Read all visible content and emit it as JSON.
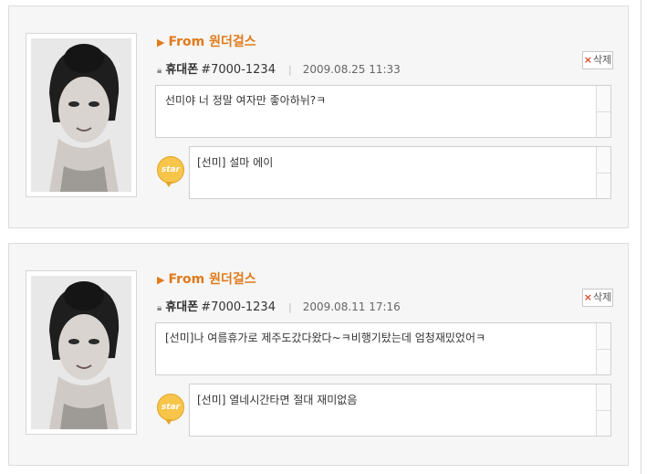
{
  "posts": [
    {
      "from_label": "From",
      "from_name": "원더걸스",
      "sender": "휴대폰",
      "phone": "#7000-1234",
      "date": "2009.08.25 11:33",
      "delete_label": "삭제",
      "message": "선미야 너 정말 여자만 좋아하뉘?ㅋ",
      "reply_badge": "star",
      "reply": "[선미] 설마 에이"
    },
    {
      "from_label": "From",
      "from_name": "원더걸스",
      "sender": "휴대폰",
      "phone": "#7000-1234",
      "date": "2009.08.11 17:16",
      "delete_label": "삭제",
      "message": "[선미]나 여름휴가로 제주도갔다왔다~ㅋ비행기탔는데 엄청재밌었어ㅋ",
      "reply_badge": "star",
      "reply": "[선미] 열네시간타면 절대 재미없음"
    }
  ],
  "colors": {
    "accent": "#e07a1a",
    "badge": "#f6c54a",
    "delete_x": "#d94a2a"
  }
}
